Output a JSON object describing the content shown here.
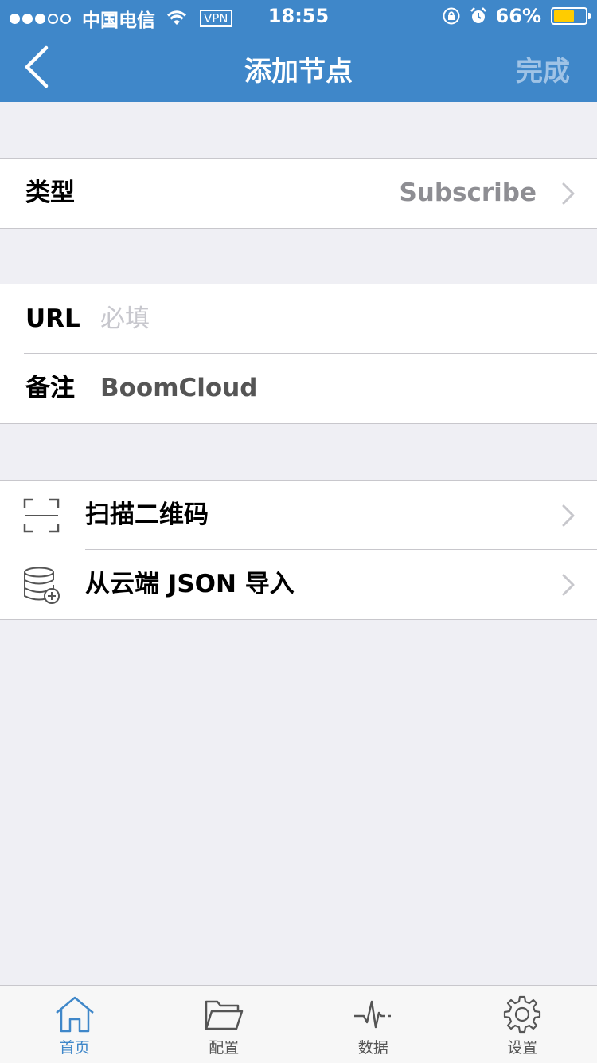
{
  "status_bar": {
    "carrier": "中国电信",
    "vpn": "VPN",
    "time": "18:55",
    "battery": "66%",
    "battery_level": 0.66
  },
  "nav": {
    "title": "添加节点",
    "done_label": "完成"
  },
  "type_row": {
    "label": "类型",
    "value": "Subscribe"
  },
  "fields": {
    "url_label": "URL",
    "url_placeholder": "必填",
    "url_value": "",
    "note_label": "备注",
    "note_value": "BoomCloud"
  },
  "actions": {
    "scan_label": "扫描二维码",
    "import_label": "从云端 JSON 导入"
  },
  "tabs": [
    {
      "label": "首页",
      "icon": "home-icon",
      "active": true
    },
    {
      "label": "配置",
      "icon": "folder-icon",
      "active": false
    },
    {
      "label": "数据",
      "icon": "pulse-icon",
      "active": false
    },
    {
      "label": "设置",
      "icon": "gear-icon",
      "active": false
    }
  ],
  "colors": {
    "accent": "#3f87c9",
    "battery": "#ffcc00",
    "background": "#efeff4"
  }
}
